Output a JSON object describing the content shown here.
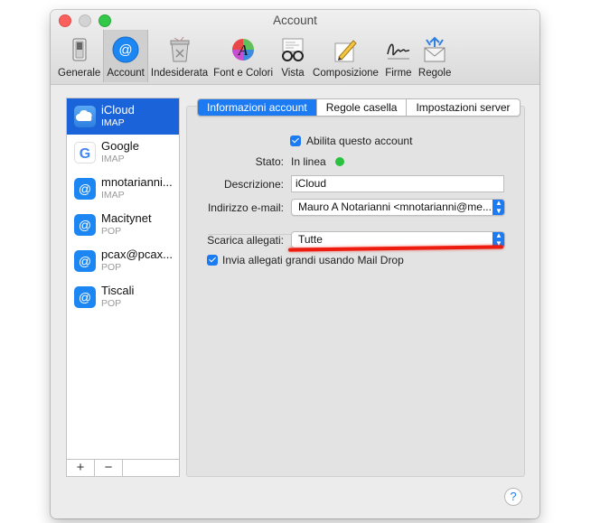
{
  "window": {
    "title": "Account"
  },
  "toolbar": {
    "items": [
      {
        "label": "Generale",
        "icon": "switch-icon"
      },
      {
        "label": "Account",
        "icon": "at-sign-icon"
      },
      {
        "label": "Indesiderata",
        "icon": "trash-bin-icon"
      },
      {
        "label": "Font e Colori",
        "icon": "font-color-icon"
      },
      {
        "label": "Vista",
        "icon": "glasses-icon"
      },
      {
        "label": "Composizione",
        "icon": "pencil-paper-icon"
      },
      {
        "label": "Firme",
        "icon": "signature-icon"
      },
      {
        "label": "Regole",
        "icon": "rules-envelope-icon"
      }
    ],
    "active": "Account"
  },
  "accounts": [
    {
      "name": "iCloud",
      "type": "IMAP",
      "icon": "icloud-icon",
      "selected": true
    },
    {
      "name": "Google",
      "type": "IMAP",
      "icon": "google-icon"
    },
    {
      "name": "mnotarianni...",
      "type": "IMAP",
      "icon": "at-sign-icon"
    },
    {
      "name": "Macitynet",
      "type": "POP",
      "icon": "at-sign-icon"
    },
    {
      "name": "pcax@pcax...",
      "type": "POP",
      "icon": "at-sign-icon"
    },
    {
      "name": "Tiscali",
      "type": "POP",
      "icon": "at-sign-icon"
    }
  ],
  "sidebar_buttons": {
    "add": "+",
    "remove": "−"
  },
  "tabs": [
    "Informazioni account",
    "Regole casella",
    "Impostazioni server"
  ],
  "form": {
    "enable_label": "Abilita questo account",
    "status_label": "Stato:",
    "status_value": "In linea",
    "description_label": "Descrizione:",
    "description_value": "iCloud",
    "email_label": "Indirizzo e-mail:",
    "email_value": "Mauro A Notarianni <mnotarianni@me....",
    "download_label": "Scarica allegati:",
    "download_value": "Tutte",
    "maildrop_label": "Invia allegati grandi usando Mail Drop"
  },
  "help": "?",
  "colors": {
    "accent": "#1c7bf3",
    "selection": "#1b63d8",
    "online": "#29c23f",
    "annotation": "#ee1c0f"
  }
}
